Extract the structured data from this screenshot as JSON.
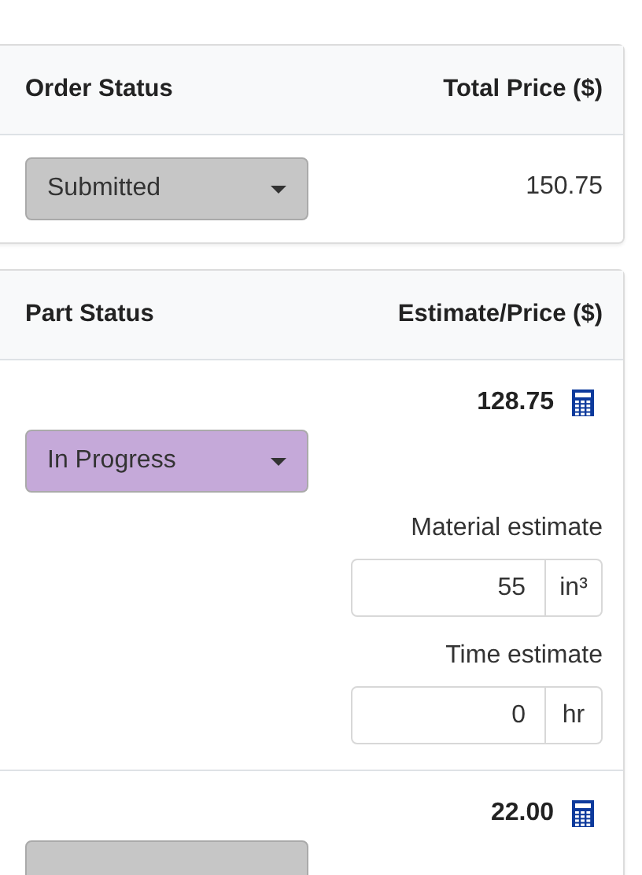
{
  "order": {
    "columns": [
      "Order Status",
      "Total Price ($)"
    ],
    "status": {
      "label": "Submitted",
      "color": "#c6c6c6"
    },
    "total": "150.75"
  },
  "parts": {
    "columns": [
      "Part Status",
      "Estimate/Price ($)"
    ],
    "rows": [
      {
        "price": "128.75",
        "status": {
          "label": "In Progress",
          "color": "#c5a9d9"
        },
        "estimates": [
          {
            "label": "Material estimate",
            "value": "55",
            "unit": "in³"
          },
          {
            "label": "Time estimate",
            "value": "0",
            "unit": "hr"
          }
        ]
      },
      {
        "price": "22.00",
        "status": {
          "color": "#c6c6c6"
        }
      }
    ]
  }
}
